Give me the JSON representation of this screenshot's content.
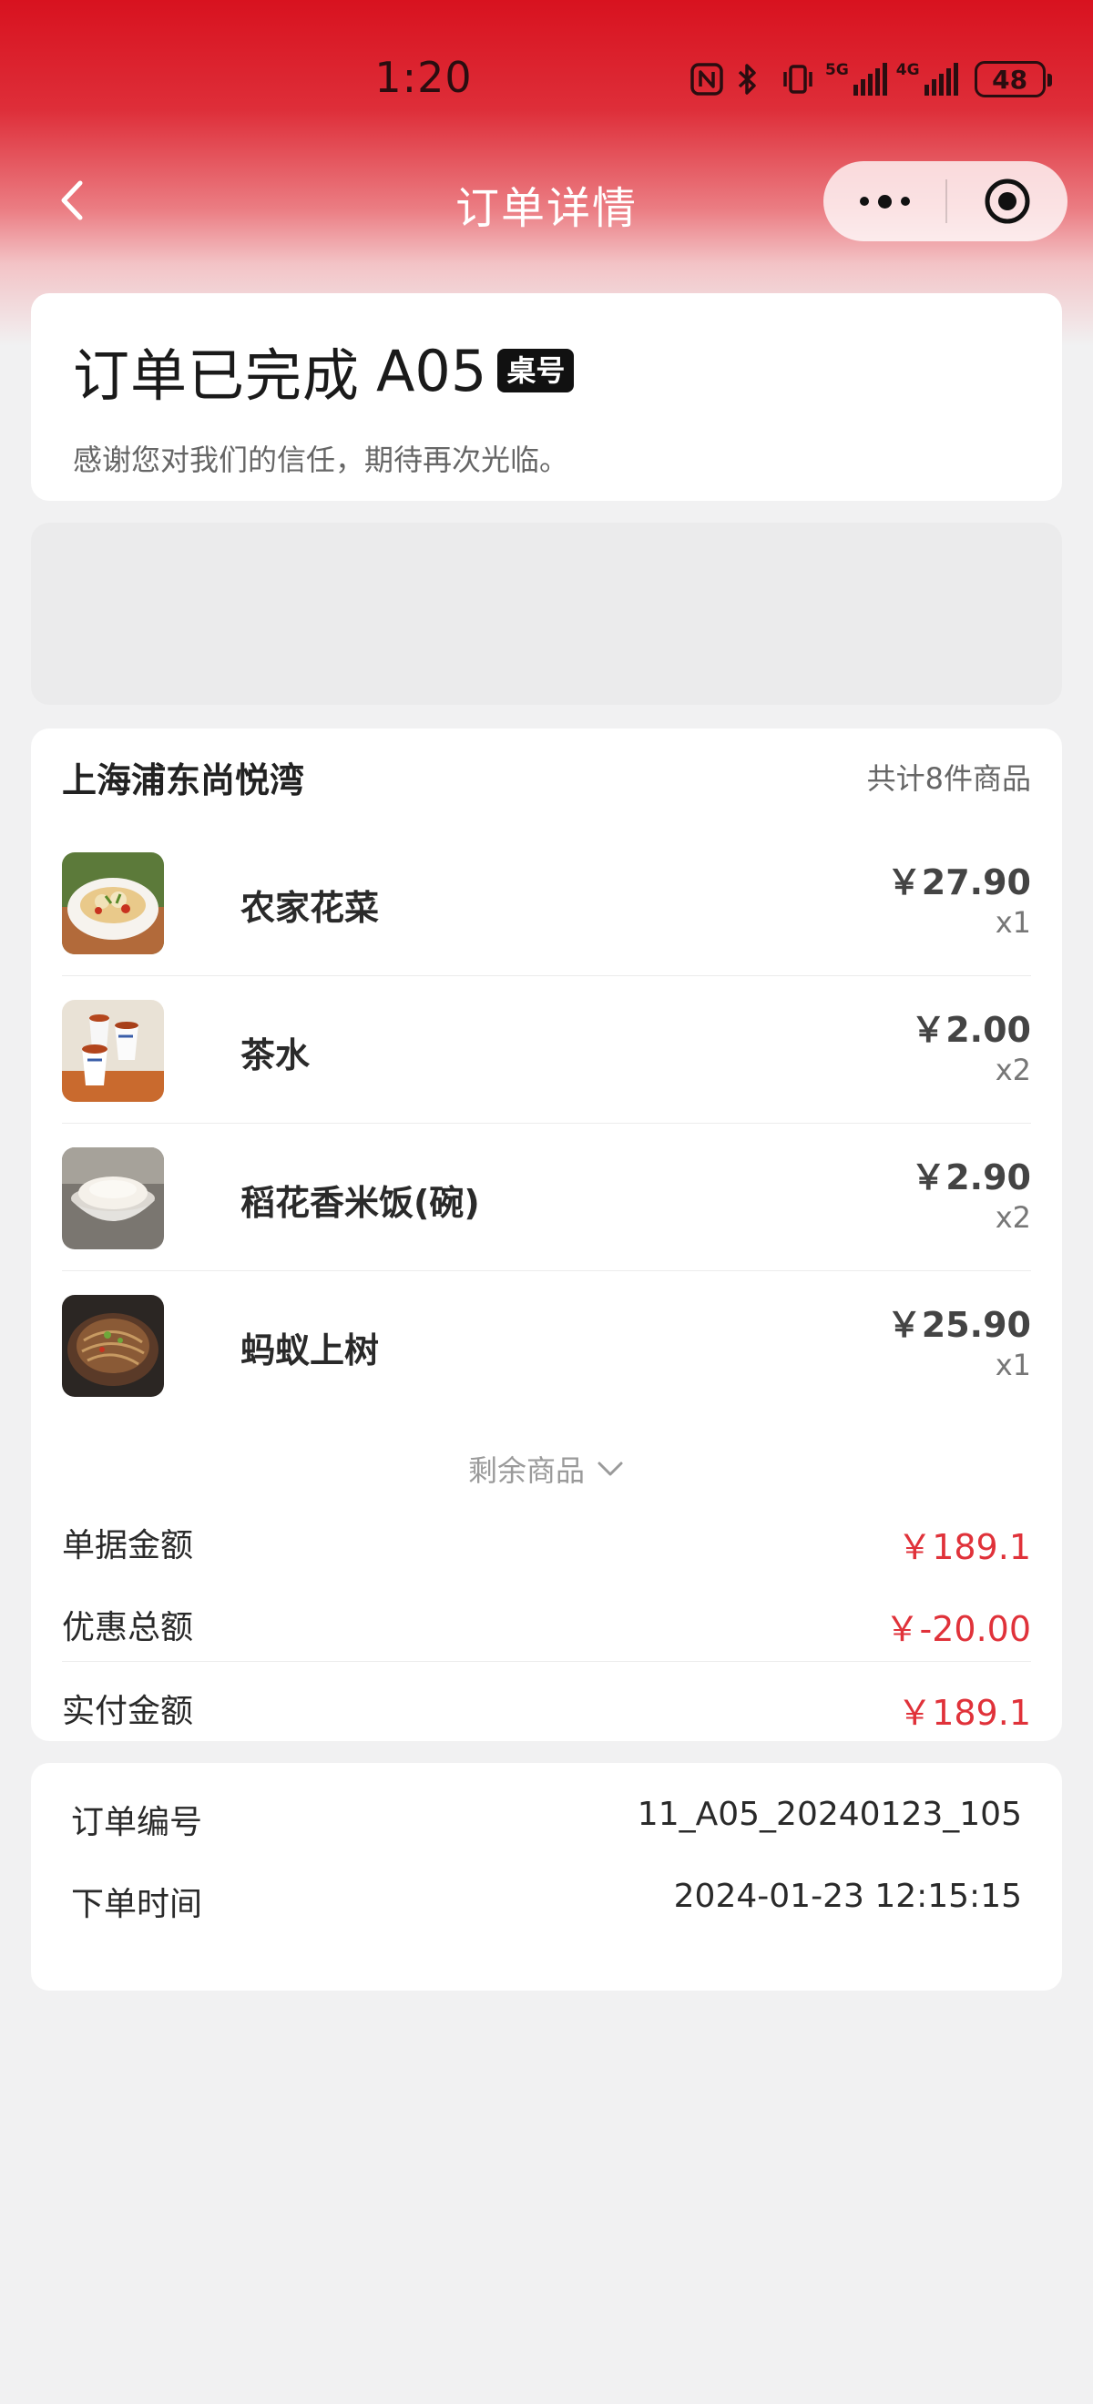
{
  "status_bar": {
    "time": "1:20",
    "net1": "5G",
    "net2": "4G",
    "battery": "48"
  },
  "navbar": {
    "title": "订单详情"
  },
  "order_status": {
    "title": "订单已完成",
    "table_no": "A05",
    "badge": "桌号",
    "subtitle": "感谢您对我们的信任，期待再次光临。"
  },
  "store": {
    "name": "上海浦东尚悦湾",
    "count_text": "共计8件商品"
  },
  "items": [
    {
      "name": "农家花菜",
      "price": "￥27.90",
      "qty": "x1",
      "image": "cauliflower-dish-icon"
    },
    {
      "name": "茶水",
      "price": "￥2.00",
      "qty": "x2",
      "image": "tea-cups-icon"
    },
    {
      "name": "稻花香米饭(碗)",
      "price": "￥2.90",
      "qty": "x2",
      "image": "rice-bowl-icon"
    },
    {
      "name": "蚂蚁上树",
      "price": "￥25.90",
      "qty": "x1",
      "image": "vermicelli-dish-icon"
    }
  ],
  "more_items": "剩余商品",
  "summary": [
    {
      "label": "单据金额",
      "value": "￥189.1"
    },
    {
      "label": "优惠总额",
      "value": "￥-20.00"
    },
    {
      "label": "实付金额",
      "value": "￥189.1"
    }
  ],
  "info": [
    {
      "label": "订单编号",
      "value": "11_A05_20240123_105"
    },
    {
      "label": "下单时间",
      "value": "2024-01-23 12:15:15"
    }
  ],
  "colors": {
    "header_red": "#d8121f",
    "price_red": "#e0323a",
    "background": "#f1f1f2"
  }
}
